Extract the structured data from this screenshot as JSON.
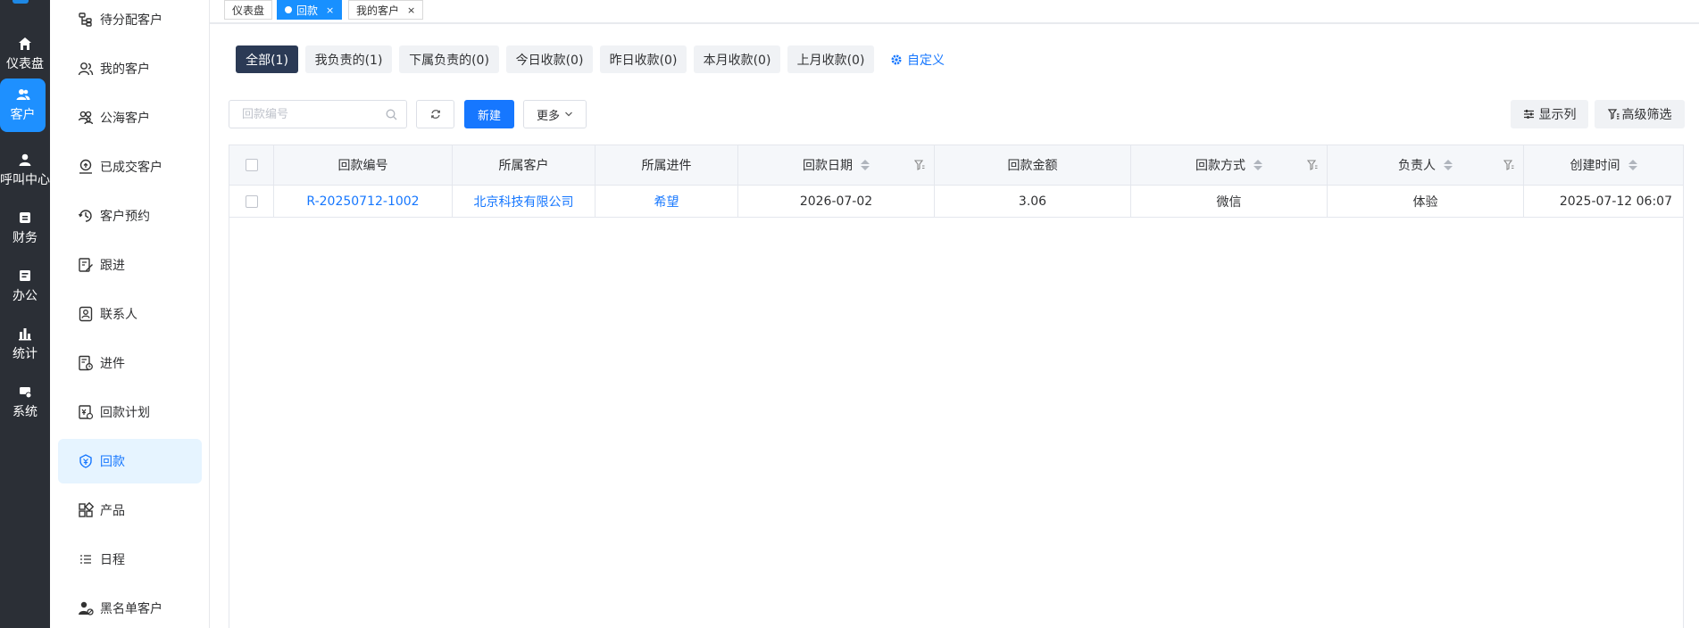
{
  "rail": {
    "items": [
      {
        "label": "仪表盘",
        "icon": "home-icon"
      },
      {
        "label": "客户",
        "icon": "users-icon"
      },
      {
        "label": "呼叫中心",
        "icon": "user-icon"
      },
      {
        "label": "财务",
        "icon": "wallet-icon"
      },
      {
        "label": "办公",
        "icon": "briefcase-icon"
      },
      {
        "label": "统计",
        "icon": "bar-chart-icon"
      },
      {
        "label": "系统",
        "icon": "settings-icon"
      }
    ]
  },
  "sidebar": {
    "items": [
      {
        "label": "待分配客户",
        "icon": "tree-icon"
      },
      {
        "label": "我的客户",
        "icon": "users-icon"
      },
      {
        "label": "公海客户",
        "icon": "group-icon"
      },
      {
        "label": "已成交客户",
        "icon": "deal-icon"
      },
      {
        "label": "客户预约",
        "icon": "clock-icon"
      },
      {
        "label": "跟进",
        "icon": "edit-icon"
      },
      {
        "label": "联系人",
        "icon": "contact-icon"
      },
      {
        "label": "进件",
        "icon": "document-icon"
      },
      {
        "label": "回款计划",
        "icon": "calendar-icon"
      },
      {
        "label": "回款",
        "icon": "payment-icon"
      },
      {
        "label": "产品",
        "icon": "grid-icon"
      },
      {
        "label": "日程",
        "icon": "list-icon"
      },
      {
        "label": "黑名单客户",
        "icon": "blacklist-icon"
      }
    ]
  },
  "tabs": [
    {
      "label": "仪表盘",
      "closable": false
    },
    {
      "label": "回款",
      "closable": true,
      "close": "×"
    },
    {
      "label": "我的客户",
      "closable": true,
      "close": "×"
    }
  ],
  "filters": {
    "chips": [
      "全部(1)",
      "我负责的(1)",
      "下属负责的(0)",
      "今日收款(0)",
      "昨日收款(0)",
      "本月收款(0)",
      "上月收款(0)"
    ],
    "customize_label": "自定义"
  },
  "toolbar": {
    "search_placeholder": "回款编号",
    "new_label": "新建",
    "more_label": "更多",
    "columns_label": "显示列",
    "advanced_filter_label": "高级筛选"
  },
  "table": {
    "headers": [
      "回款编号",
      "所属客户",
      "所属进件",
      "回款日期",
      "回款金额",
      "回款方式",
      "负责人",
      "创建时间"
    ],
    "rows": [
      [
        "R-20250712-1002",
        "北京科技有限公司",
        "希望",
        "2026-07-02",
        "3.06",
        "微信",
        "体验",
        "2025-07-12 06:07"
      ]
    ]
  },
  "colors": {
    "accent": "#1677ff",
    "rail_bg": "#2b2f36",
    "chip_active": "#2b3a55"
  }
}
